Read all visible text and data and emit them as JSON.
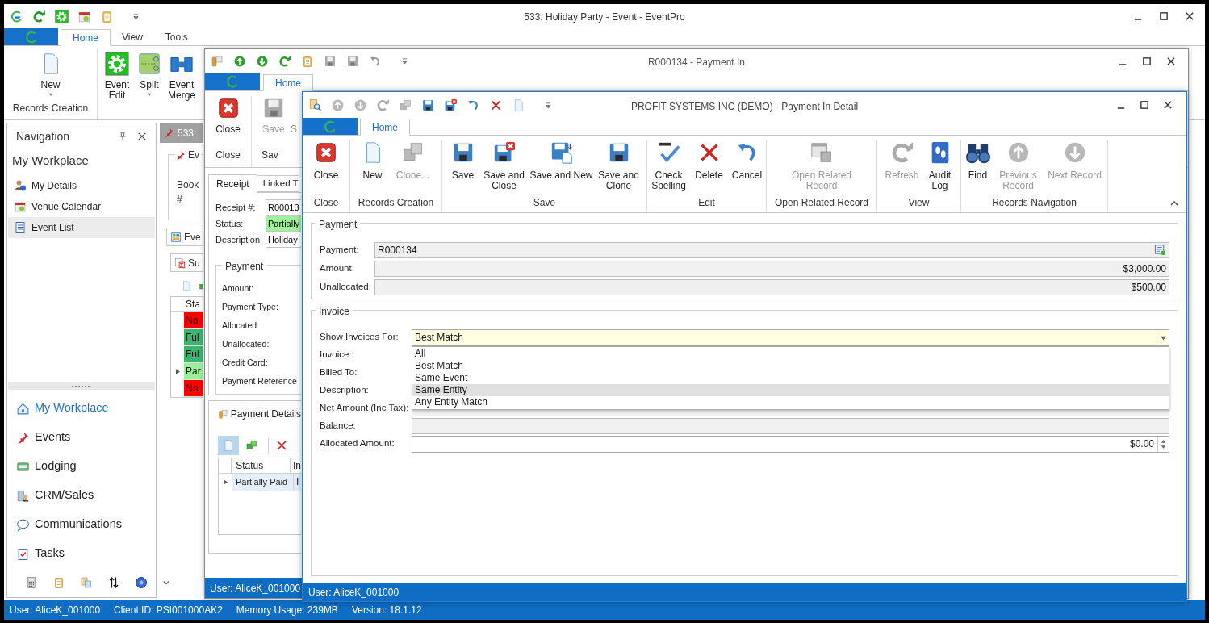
{
  "main_window": {
    "title": "533: Holiday Party - Event - EventPro",
    "tabs": [
      {
        "label": "Home",
        "selected": true
      },
      {
        "label": "View",
        "selected": false
      },
      {
        "label": "Tools",
        "selected": false
      }
    ],
    "ribbon_groups": [
      {
        "label": "Records Creation",
        "buttons": [
          {
            "label": "New",
            "dropdown": true
          }
        ]
      },
      {
        "buttons": [
          {
            "label": "Event Edit",
            "dropdown": false
          },
          {
            "label": "Split",
            "dropdown": true
          },
          {
            "label": "Event Merge",
            "dropdown": false
          }
        ]
      }
    ]
  },
  "navigation": {
    "title": "Navigation",
    "section": "My Workplace",
    "items": [
      {
        "label": "My Details",
        "selected": false
      },
      {
        "label": "Venue Calendar",
        "selected": false
      },
      {
        "label": "Event List",
        "selected": true
      }
    ],
    "modules": [
      {
        "label": "My Workplace",
        "selected": true
      },
      {
        "label": "Events",
        "selected": false
      },
      {
        "label": "Lodging",
        "selected": false
      },
      {
        "label": "CRM/Sales",
        "selected": false
      },
      {
        "label": "Communications",
        "selected": false
      },
      {
        "label": "Tasks",
        "selected": false
      }
    ]
  },
  "event_panel": {
    "tab": "533:",
    "group": "Ev",
    "book_label": "Book #",
    "tabs": [
      "Eve",
      "Su"
    ],
    "column": "Sta",
    "rows": [
      {
        "status": "No",
        "color": "#ff0000",
        "current": false
      },
      {
        "status": "Ful",
        "color": "#3cb371",
        "current": false
      },
      {
        "status": "Ful",
        "color": "#3cb371",
        "current": false
      },
      {
        "status": "Par",
        "color": "#98f098",
        "current": true
      },
      {
        "status": "No",
        "color": "#ff0000",
        "current": false
      }
    ]
  },
  "payment_in_window": {
    "title": "R000134 - Payment In",
    "tabs": [
      {
        "label": "Home",
        "selected": true
      }
    ],
    "ribbon_groups": [
      {
        "label": "Close",
        "buttons": [
          {
            "label": "Close",
            "disabled": false
          }
        ]
      },
      {
        "label": "Sav",
        "buttons": [
          {
            "label": "Save",
            "disabled": true
          },
          {
            "label": "S",
            "disabled": true
          }
        ]
      }
    ],
    "record_tabs": [
      {
        "label": "Receipt",
        "selected": true
      },
      {
        "label": "Linked T",
        "selected": false
      }
    ],
    "fields": [
      {
        "label": "Receipt #:",
        "value": "R00013",
        "kind": "text"
      },
      {
        "label": "Status:",
        "value": "Partially",
        "kind": "status"
      },
      {
        "label": "Description:",
        "value": "Holiday",
        "kind": "text"
      }
    ],
    "payment_group": {
      "title": "Payment",
      "labels": [
        "Amount:",
        "Payment Type:",
        "Allocated:",
        "Unallocated:",
        "Credit Card:",
        "Payment Reference"
      ]
    },
    "details": {
      "title": "Payment Details",
      "columns": [
        "Status",
        "In"
      ],
      "rows": [
        {
          "cells": [
            "Partially Paid",
            "I"
          ],
          "current": true
        }
      ]
    },
    "status_bar": "User: AliceK_001000"
  },
  "detail_dialog": {
    "title": "PROFIT SYSTEMS INC (DEMO) - Payment In Detail",
    "tabs": [
      {
        "label": "Home",
        "selected": true
      }
    ],
    "ribbon_groups": [
      {
        "label": "Close",
        "buttons": [
          {
            "label": "Close",
            "disabled": false
          }
        ]
      },
      {
        "label": "Records Creation",
        "buttons": [
          {
            "label": "New",
            "disabled": false
          },
          {
            "label": "Clone...",
            "disabled": true
          }
        ]
      },
      {
        "label": "Save",
        "buttons": [
          {
            "label": "Save",
            "disabled": false
          },
          {
            "label": "Save and Close",
            "disabled": false
          },
          {
            "label": "Save and New",
            "disabled": false
          },
          {
            "label": "Save and Clone",
            "disabled": false
          }
        ]
      },
      {
        "label": "Edit",
        "buttons": [
          {
            "label": "Check Spelling",
            "disabled": false
          },
          {
            "label": "Delete",
            "disabled": false
          },
          {
            "label": "Cancel",
            "disabled": false
          }
        ]
      },
      {
        "label": "Open Related Record",
        "buttons": [
          {
            "label": "Open Related Record",
            "disabled": true
          }
        ]
      },
      {
        "label": "View",
        "buttons": [
          {
            "label": "Refresh",
            "disabled": true
          },
          {
            "label": "Audit Log",
            "disabled": false
          }
        ]
      },
      {
        "label": "Records Navigation",
        "buttons": [
          {
            "label": "Find",
            "disabled": false
          },
          {
            "label": "Previous Record",
            "disabled": true
          },
          {
            "label": "Next Record",
            "disabled": true
          }
        ]
      }
    ],
    "payment": {
      "title": "Payment",
      "fields": [
        {
          "label": "Payment:",
          "value": "R000134",
          "kind": "lookup"
        },
        {
          "label": "Amount:",
          "value": "$3,000.00",
          "kind": "amount"
        },
        {
          "label": "Unallocated:",
          "value": "$500.00",
          "kind": "amount"
        }
      ]
    },
    "invoice": {
      "title": "Invoice",
      "show_for": {
        "label": "Show Invoices For:",
        "value": "Best Match",
        "expanded": true,
        "options": [
          {
            "label": "All",
            "highlighted": false
          },
          {
            "label": "Best Match",
            "highlighted": false
          },
          {
            "label": "Same Event",
            "highlighted": false
          },
          {
            "label": "Same Entity",
            "highlighted": true
          },
          {
            "label": "Any Entity Match",
            "highlighted": false
          }
        ]
      },
      "fields": [
        {
          "label": "Invoice:",
          "kind": "covered"
        },
        {
          "label": "Billed To:",
          "kind": "covered"
        },
        {
          "label": "Description:",
          "kind": "covered"
        },
        {
          "label": "Net Amount (Inc Tax):",
          "kind": "readonly"
        },
        {
          "label": "Balance:",
          "kind": "readonly"
        },
        {
          "label": "Allocated Amount:",
          "value": "$0.00",
          "kind": "spin"
        }
      ]
    },
    "status_bar": "User: AliceK_001000"
  },
  "status_bar": [
    "User: AliceK_001000",
    "Client ID: PSI001000AK2",
    "Memory Usage: 239MB",
    "Version: 18.1.12"
  ]
}
